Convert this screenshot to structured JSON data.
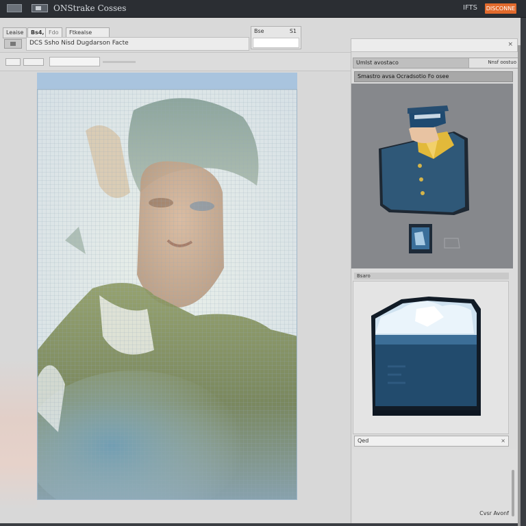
{
  "titlebar": {
    "title": "ONStrake Cosses",
    "right_label": "IFTS",
    "button_label": "DISCONNE"
  },
  "toolbar": {
    "button1_label": "Leaise",
    "button2_label": "Bs4,",
    "button3_label": "Fdo",
    "button4_label": "Ftkealse",
    "path_text": "DCS Ssho Nisd Dugdarson Facte",
    "dropdown_label": "Bse",
    "dropdown_value": "S1"
  },
  "right_panel": {
    "header_left": "UmIst avostaco",
    "header_right": "Nnsf oostuo",
    "subheader": "Smastro avsa Ocradsotio Fo osee",
    "preview2_label": "Bsaro",
    "field_label": "Qed",
    "field_close": "×",
    "bottom_text": "Cvsr Avonf"
  },
  "icons": {
    "top_right_close": "×"
  }
}
